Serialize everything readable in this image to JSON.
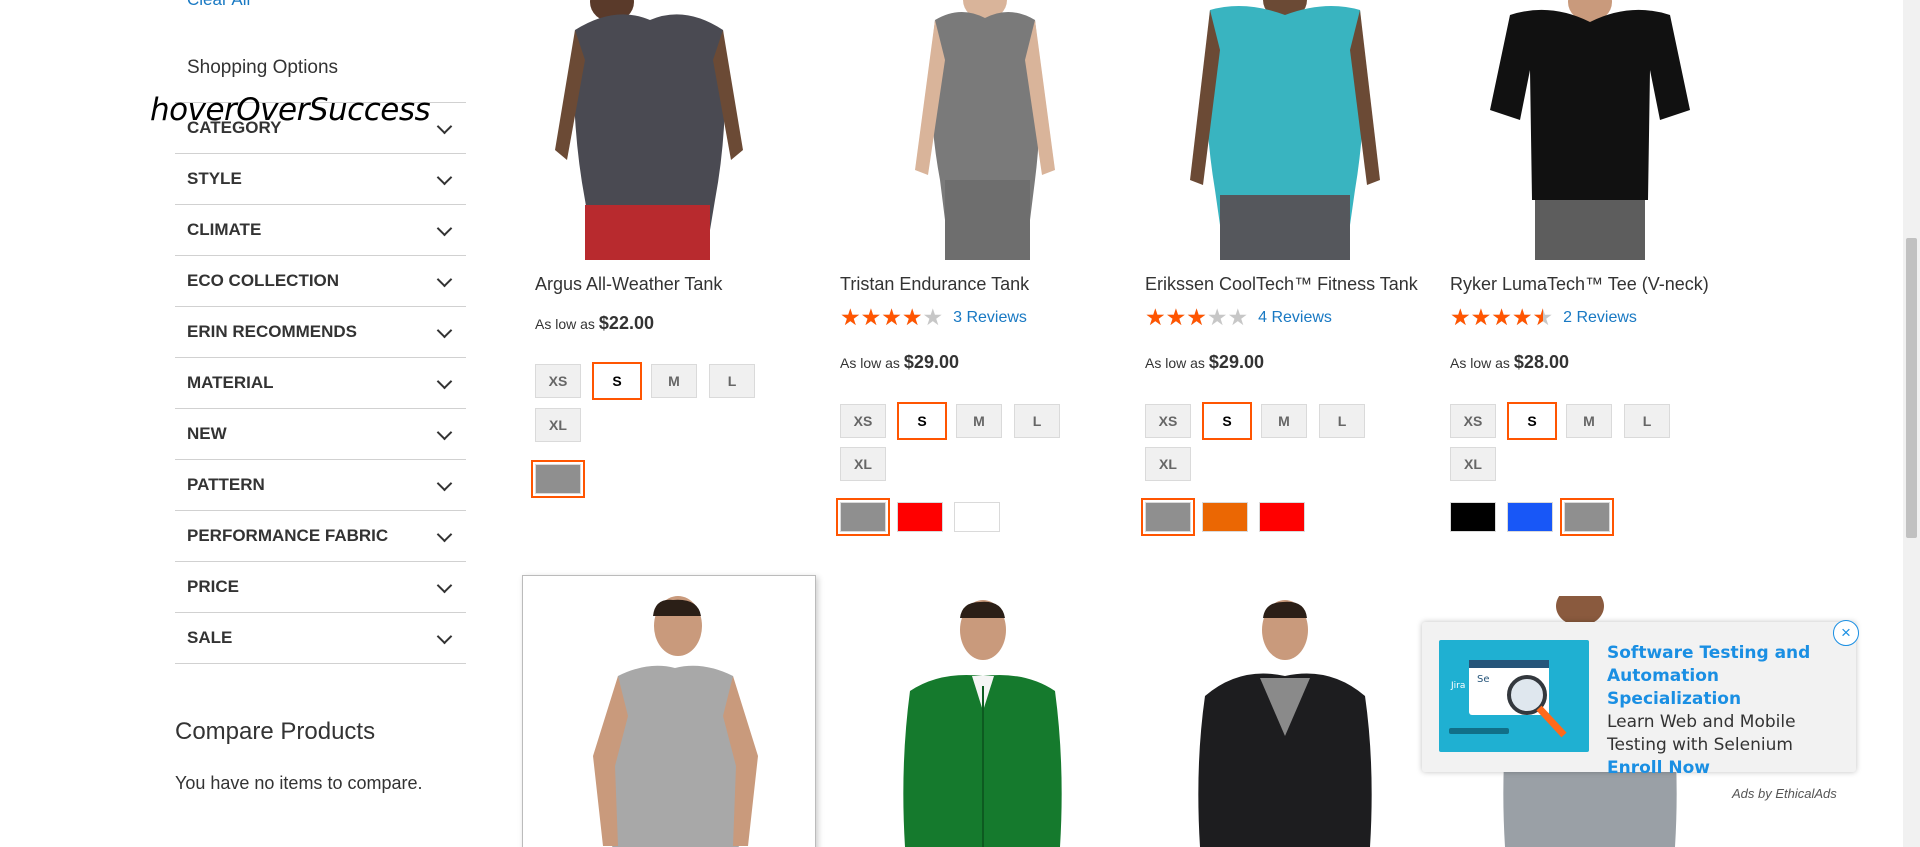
{
  "sidebar": {
    "clear_all": "Clear All",
    "shopping_options": "Shopping Options",
    "hover_overlay": "hoverOverSuccess",
    "filters": [
      {
        "label": "CATEGORY"
      },
      {
        "label": "STYLE"
      },
      {
        "label": "CLIMATE"
      },
      {
        "label": "ECO COLLECTION"
      },
      {
        "label": "ERIN RECOMMENDS"
      },
      {
        "label": "MATERIAL"
      },
      {
        "label": "NEW"
      },
      {
        "label": "PATTERN"
      },
      {
        "label": "PERFORMANCE FABRIC"
      },
      {
        "label": "PRICE"
      },
      {
        "label": "SALE"
      }
    ],
    "compare_title": "Compare Products",
    "compare_empty": "You have no items to compare."
  },
  "products": [
    {
      "name": "Argus All-Weather Tank",
      "price_prefix": "As low as",
      "price": "$22.00",
      "sizes": [
        "XS",
        "S",
        "M",
        "L",
        "XL"
      ],
      "selected_size": "S",
      "colors": [
        "#8f8f8f"
      ],
      "selected_color": 0
    },
    {
      "name": "Tristan Endurance Tank",
      "rating_percent": 80,
      "reviews": "3 Reviews",
      "price_prefix": "As low as",
      "price": "$29.00",
      "sizes": [
        "XS",
        "S",
        "M",
        "L",
        "XL"
      ],
      "selected_size": "S",
      "colors": [
        "#8f8f8f",
        "#ff0000",
        "#ffffff"
      ],
      "selected_color": 0
    },
    {
      "name": "Erikssen CoolTech™ Fitness Tank",
      "rating_percent": 60,
      "reviews": "4 Reviews",
      "price_prefix": "As low as",
      "price": "$29.00",
      "sizes": [
        "XS",
        "S",
        "M",
        "L",
        "XL"
      ],
      "selected_size": "S",
      "colors": [
        "#8f8f8f",
        "#eb6703",
        "#ff0000"
      ],
      "selected_color": 0
    },
    {
      "name": "Ryker LumaTech™ Tee (V-neck)",
      "rating_percent": 90,
      "reviews": "2 Reviews",
      "price_prefix": "As low as",
      "price": "$28.00",
      "sizes": [
        "XS",
        "S",
        "M",
        "L",
        "XL"
      ],
      "selected_size": "S",
      "colors": [
        "#000000",
        "#1857f7",
        "#8f8f8f"
      ],
      "selected_color": 2
    }
  ],
  "ad": {
    "title": "Software Testing and Automation Specialization",
    "body": "Learn Web and Mobile Testing with Selenium",
    "cta": "Enroll Now",
    "close": "×",
    "by": "Ads by EthicalAds",
    "image_labels": [
      "Jira",
      "Se"
    ]
  },
  "colors": {
    "accent": "#ff5501",
    "link": "#1979c3",
    "ad_link": "#1a8fe3"
  }
}
